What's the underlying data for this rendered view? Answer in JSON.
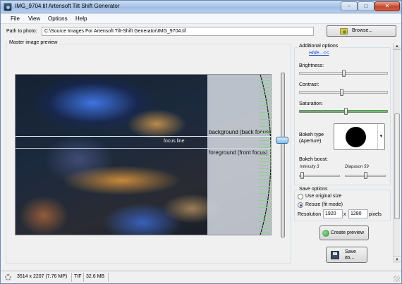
{
  "window": {
    "title": "IMG_9704.tif Artensoft Tilt Shift Generator",
    "icon": "tilt-shift-app-icon",
    "controls": {
      "minimize": "–",
      "maximize": "□",
      "close": "✕"
    }
  },
  "menu": {
    "items": [
      "File",
      "View",
      "Options",
      "Help"
    ]
  },
  "path": {
    "label": "Path to photo:",
    "value": "C:\\Source Images For Artensoft Tilt-Shift Generator\\IMG_9704.tif",
    "browse_label": "Browse...",
    "browse_icon": "folder-open-icon"
  },
  "preview": {
    "caption": "Master image preview",
    "lines": {
      "background": "background (back focus)",
      "focus": "focus line",
      "foreground": "foreground (front focus)"
    }
  },
  "options": {
    "caption": "Additional options",
    "hide_link": "Hide...<<",
    "brightness_label": "Brightness:",
    "contrast_label": "Contrast:",
    "saturation_label": "Saturation:",
    "brightness_level": 0.5,
    "contrast_level": 0.48,
    "saturation_level": 0.53,
    "bokeh_type_label": "Bokeh type\n(Aperture)",
    "bokeh_shape": "circle",
    "bokeh_boost_label": "Bokeh boost:",
    "intensity_label": "Intensity 3",
    "diapason_label": "Diapason 59",
    "intensity_level": 0.03,
    "diapason_level": 0.5
  },
  "save_options": {
    "caption": "Save options",
    "use_original_label": "Use original size",
    "resize_label": "Resize (fit mode)",
    "selected": "resize",
    "resolution_label": "Resolution",
    "width": "1920",
    "x_label": "x",
    "height": "1280",
    "pixels_label": "pixels"
  },
  "actions": {
    "create_preview_label": "Create preview",
    "save_label_line1": "Save",
    "save_label_line2": "as..."
  },
  "status": {
    "dimensions": "3514 x 2207 (7.76 MP)",
    "format": "TIF",
    "size": "32.6 MB"
  },
  "colors": {
    "titlebar": "#a9c4e6",
    "accent_link": "#1a4cc6",
    "saturation_track": "#6fc46f",
    "close_button": "#c7452a"
  }
}
